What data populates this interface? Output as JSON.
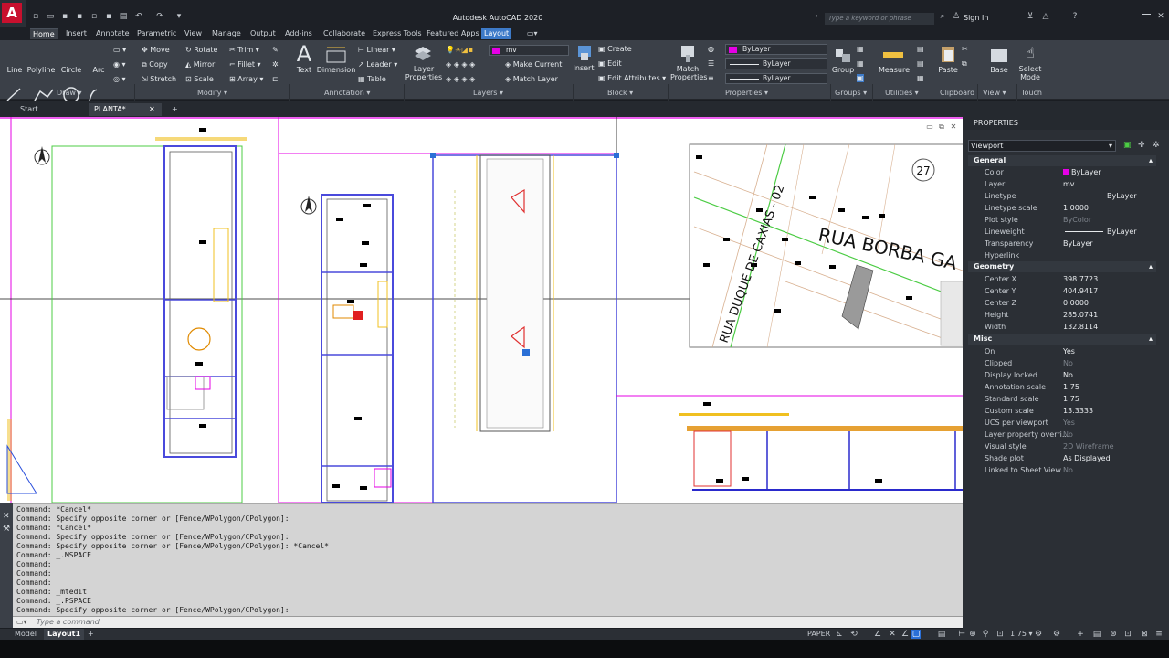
{
  "app": {
    "logo_letter": "A",
    "title": "Autodesk AutoCAD 2020",
    "search_placeholder": "Type a keyword or phrase",
    "sign_in": "Sign In"
  },
  "ribbon_tabs": [
    "Home",
    "Insert",
    "Annotate",
    "Parametric",
    "View",
    "Manage",
    "Output",
    "Add-ins",
    "Collaborate",
    "Express Tools",
    "Featured Apps",
    "Layout"
  ],
  "draw_panel": {
    "label": "Draw",
    "tools": [
      "Line",
      "Polyline",
      "Circle",
      "Arc"
    ]
  },
  "modify_panel": {
    "label": "Modify",
    "rows": [
      [
        "Move",
        "Rotate",
        "Trim"
      ],
      [
        "Copy",
        "Mirror",
        "Fillet"
      ],
      [
        "Stretch",
        "Scale",
        "Array"
      ]
    ]
  },
  "annotation_panel": {
    "label": "Annotation",
    "text": "Text",
    "dimension": "Dimension",
    "rows": [
      "Linear",
      "Leader",
      "Table"
    ]
  },
  "layers_panel": {
    "label": "Layers",
    "layer_properties": "Layer Properties",
    "current_layer": "mv",
    "make_current": "Make Current",
    "match_layer": "Match Layer"
  },
  "block_panel": {
    "label": "Block",
    "insert": "Insert",
    "rows": [
      "Create",
      "Edit",
      "Edit Attributes"
    ]
  },
  "properties_panel": {
    "label": "Properties",
    "match_properties": "Match Properties",
    "color": "ByLayer",
    "linetype": "ByLayer",
    "lineweight": "ByLayer",
    "accent_color": "#e600e6"
  },
  "groups_panel": {
    "label": "Groups",
    "group": "Group"
  },
  "utilities_panel": {
    "label": "Utilities",
    "measure": "Measure"
  },
  "clipboard_panel": {
    "label": "Clipboard",
    "paste": "Paste"
  },
  "view_panel": {
    "label": "View",
    "base": "Base"
  },
  "touch_panel": {
    "label": "Touch",
    "select_mode": "Select Mode"
  },
  "doc_tabs": [
    "Start",
    "PLANTA*"
  ],
  "drawing": {
    "map_street1": "RUA BORBA GA",
    "map_street2": "RUA DUQUE DE CAXIAS - 02",
    "map_lot": "27"
  },
  "properties": {
    "header": "PROPERTIES",
    "selection": "Viewport",
    "sections": {
      "general": {
        "title": "General",
        "rows": [
          {
            "label": "Color",
            "value": "ByLayer"
          },
          {
            "label": "Layer",
            "value": "mv"
          },
          {
            "label": "Linetype",
            "value": "ByLayer"
          },
          {
            "label": "Linetype scale",
            "value": "1.0000"
          },
          {
            "label": "Plot style",
            "value": "ByColor"
          },
          {
            "label": "Lineweight",
            "value": "ByLayer"
          },
          {
            "label": "Transparency",
            "value": "ByLayer"
          },
          {
            "label": "Hyperlink",
            "value": ""
          }
        ]
      },
      "geometry": {
        "title": "Geometry",
        "rows": [
          {
            "label": "Center X",
            "value": "398.7723"
          },
          {
            "label": "Center Y",
            "value": "404.9417"
          },
          {
            "label": "Center Z",
            "value": "0.0000"
          },
          {
            "label": "Height",
            "value": "285.0741"
          },
          {
            "label": "Width",
            "value": "132.8114"
          }
        ]
      },
      "misc": {
        "title": "Misc",
        "rows": [
          {
            "label": "On",
            "value": "Yes"
          },
          {
            "label": "Clipped",
            "value": "No"
          },
          {
            "label": "Display locked",
            "value": "No"
          },
          {
            "label": "Annotation scale",
            "value": "1:75"
          },
          {
            "label": "Standard scale",
            "value": "1:75"
          },
          {
            "label": "Custom scale",
            "value": "13.3333"
          },
          {
            "label": "UCS per viewport",
            "value": "Yes"
          },
          {
            "label": "Layer property overri...",
            "value": "No"
          },
          {
            "label": "Visual style",
            "value": "2D Wireframe"
          },
          {
            "label": "Shade plot",
            "value": "As Displayed"
          },
          {
            "label": "Linked to Sheet View",
            "value": "No"
          }
        ]
      }
    }
  },
  "command_history": [
    "Command: *Cancel*",
    "Command: Specify opposite corner or [Fence/WPolygon/CPolygon]:",
    "Command: *Cancel*",
    "Command: Specify opposite corner or [Fence/WPolygon/CPolygon]:",
    "Command: Specify opposite corner or [Fence/WPolygon/CPolygon]: *Cancel*",
    "Command: _.MSPACE",
    "Command:",
    "Command:",
    "Command:",
    "Command: _mtedit",
    "Command: _.PSPACE",
    "Command: Specify opposite corner or [Fence/WPolygon/CPolygon]:"
  ],
  "command_placeholder": "Type a command",
  "layout_tabs": [
    "Model",
    "Layout1"
  ],
  "status": {
    "space": "PAPER",
    "scale": "1:75"
  }
}
